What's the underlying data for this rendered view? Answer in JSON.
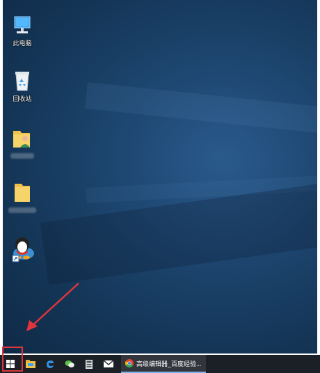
{
  "desktop": {
    "icons": [
      {
        "label": "此电脑",
        "icon": "computer-icon"
      },
      {
        "label": "回收站",
        "icon": "recycle-bin-icon"
      },
      {
        "label": "",
        "icon": "user-folder-icon"
      },
      {
        "label": "",
        "icon": "folder-icon"
      },
      {
        "label": "",
        "icon": "qq-penguin-icon"
      }
    ]
  },
  "annotation": {
    "arrow_color": "#e0353b",
    "highlight_color": "#e0353b"
  },
  "taskbar": {
    "start_icon": "windows-logo-icon",
    "pinned": [
      "file-explorer-icon",
      "edge-icon",
      "wechat-icon",
      "calculator-icon",
      "mail-icon"
    ],
    "active_app": {
      "icon": "chrome-icon",
      "title": "高级编辑器_百度经验..."
    }
  }
}
